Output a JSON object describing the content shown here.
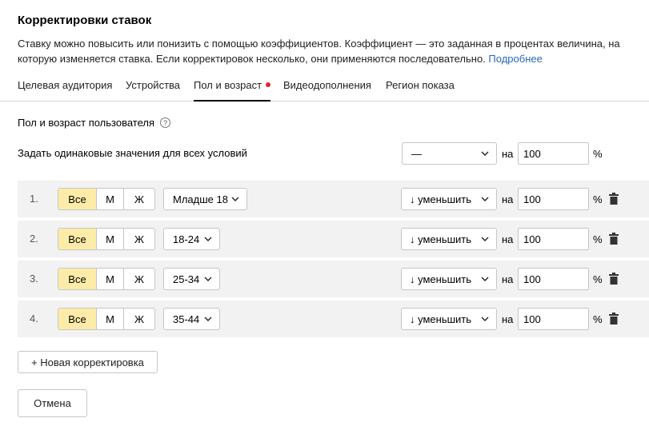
{
  "header": {
    "title": "Корректировки ставок",
    "description": "Ставку можно повысить или понизить с помощью коэффициентов. Коэффициент — это заданная в процентах величина, на которую изменяется ставка. Если корректировок несколько, они применяются последовательно.",
    "more_link": "Подробнее"
  },
  "tabs": [
    {
      "label": "Целевая аудитория"
    },
    {
      "label": "Устройства"
    },
    {
      "label": "Пол и возраст",
      "active": true,
      "has_dot": true
    },
    {
      "label": "Видеодополнения"
    },
    {
      "label": "Регион показа"
    }
  ],
  "section": {
    "label": "Пол и возраст пользователя",
    "help_icon": "?"
  },
  "all_conditions": {
    "label": "Задать одинаковые значения для всех условий",
    "select_value": "—",
    "on_label": "на",
    "value": "100",
    "percent": "%"
  },
  "gender_options": {
    "all": "Все",
    "male": "М",
    "female": "Ж"
  },
  "rows": [
    {
      "num": "1.",
      "age": "Младше 18",
      "action": "↓ уменьшить",
      "on_label": "на",
      "value": "100",
      "percent": "%"
    },
    {
      "num": "2.",
      "age": "18-24",
      "action": "↓ уменьшить",
      "on_label": "на",
      "value": "100",
      "percent": "%"
    },
    {
      "num": "3.",
      "age": "25-34",
      "action": "↓ уменьшить",
      "on_label": "на",
      "value": "100",
      "percent": "%"
    },
    {
      "num": "4.",
      "age": "35-44",
      "action": "↓ уменьшить",
      "on_label": "на",
      "value": "100",
      "percent": "%"
    }
  ],
  "buttons": {
    "add": "+ Новая корректировка",
    "cancel": "Отмена"
  },
  "colors": {
    "accent_segment": "#fdeca8",
    "link": "#2a6ab5",
    "dot": "#e0262b",
    "row_bg": "#f2f2f2"
  }
}
